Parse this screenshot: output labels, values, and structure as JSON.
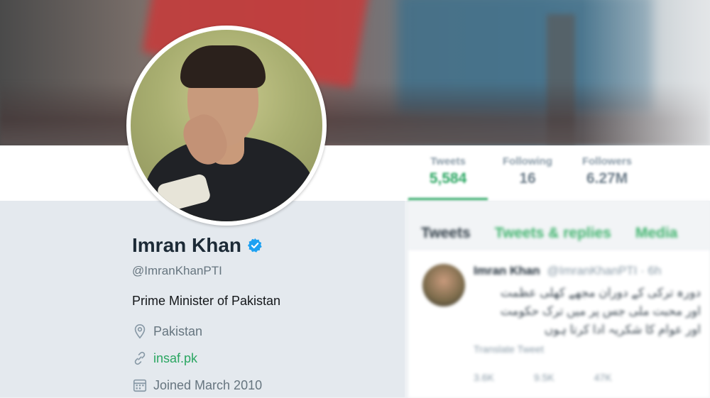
{
  "header": {
    "stats": [
      {
        "label": "Tweets",
        "value": "5,584",
        "active": true
      },
      {
        "label": "Following",
        "value": "16",
        "active": false
      },
      {
        "label": "Followers",
        "value": "6.27M",
        "active": false
      }
    ]
  },
  "profile": {
    "name": "Imran Khan",
    "handle": "@ImranKhanPTI",
    "bio": "Prime Minister of Pakistan",
    "location": "Pakistan",
    "url": "insaf.pk",
    "joined": "Joined March 2010",
    "icons": {
      "verified": "verified-badge-icon",
      "location": "location-pin-icon",
      "link": "link-icon",
      "calendar": "calendar-icon"
    }
  },
  "timeline": {
    "tabs": [
      "Tweets",
      "Tweets & replies",
      "Media"
    ],
    "tweet": {
      "name": "Imran Khan",
      "handle": "@ImranKhanPTI · 6h",
      "text": "دورہ ترکی کے دوران مجھے کھلی عظمت اور محبت ملی جس پر میں ترک حکومت اور عوام کا شکریہ ادا کرتا ہوں",
      "translate": "Translate Tweet",
      "actions": [
        "3.6K",
        "9.5K",
        "47K"
      ]
    }
  },
  "colors": {
    "accent": "#2aa661",
    "verified": "#1da1f2",
    "text": "#14171a",
    "muted": "#66757f"
  }
}
